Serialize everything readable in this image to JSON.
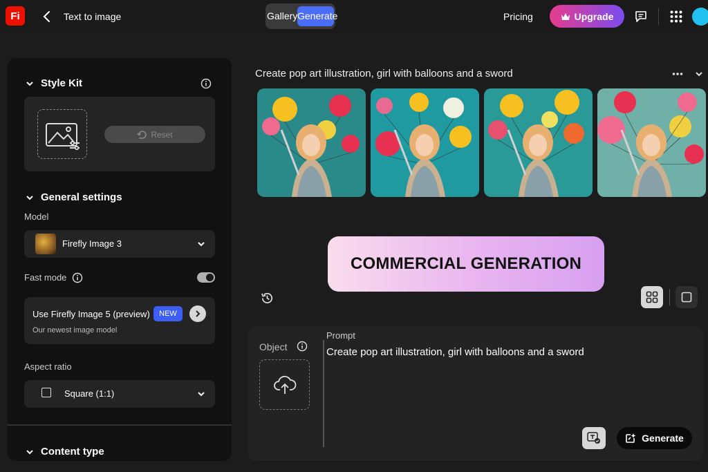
{
  "app": {
    "logo": "Fi",
    "page_title": "Text to image"
  },
  "topnav": {
    "gallery_label": "Gallery",
    "generate_label": "Generate",
    "pricing_label": "Pricing",
    "upgrade_label": "Upgrade"
  },
  "sidebar": {
    "style_kit": {
      "title": "Style Kit",
      "reset_label": "Reset"
    },
    "general": {
      "title": "General settings"
    },
    "model": {
      "label": "Model",
      "value": "Firefly Image 3"
    },
    "fast_mode": {
      "label": "Fast mode",
      "enabled": true
    },
    "promo": {
      "title": "Use Firefly Image 5 (preview)",
      "badge": "NEW",
      "subtitle": "Our newest image model"
    },
    "aspect_ratio": {
      "label": "Aspect ratio",
      "value": "Square (1:1)"
    },
    "content_type": {
      "title": "Content type"
    }
  },
  "main": {
    "prompt_heading": "Create pop art illustration, girl with balloons and a sword",
    "banner_text": "COMMERCIAL GENERATION",
    "results": [
      {
        "name": "result-image-1",
        "bg": "#2a8a8a"
      },
      {
        "name": "result-image-2",
        "bg": "#1f9aa0"
      },
      {
        "name": "result-image-3",
        "bg": "#2a9a98"
      },
      {
        "name": "result-image-4",
        "bg": "#6fb0a8"
      }
    ]
  },
  "prompt_panel": {
    "object_label": "Object",
    "prompt_label": "Prompt",
    "prompt_text": "Create pop art illustration, girl with balloons and a sword",
    "generate_label": "Generate"
  },
  "colors": {
    "accent": "#4b6cf5",
    "logo": "#eb1000",
    "upgrade_start": "#e63c8c",
    "upgrade_end": "#7b4cf0"
  }
}
